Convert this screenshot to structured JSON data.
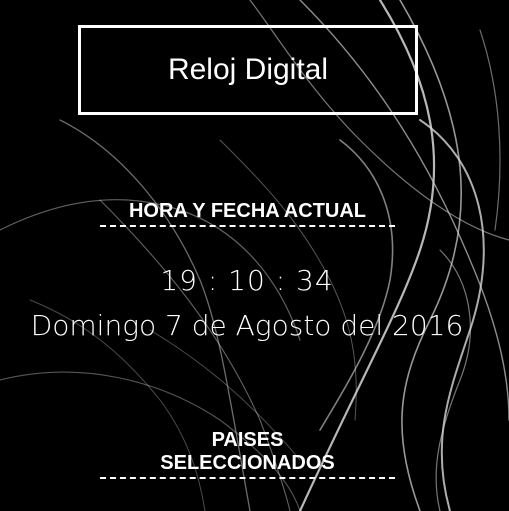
{
  "header": {
    "title": "Reloj Digital"
  },
  "clock_section": {
    "heading": "HORA Y FECHA ACTUAL",
    "time": "19 : 10 : 34",
    "date": "Domingo 7 de Agosto del 2016"
  },
  "countries_section": {
    "heading_line1": "PAISES",
    "heading_line2": "SELECCIONADOS"
  },
  "colors": {
    "background": "#000000",
    "text": "#ffffff",
    "light_streaks": "#cfcfcf"
  }
}
